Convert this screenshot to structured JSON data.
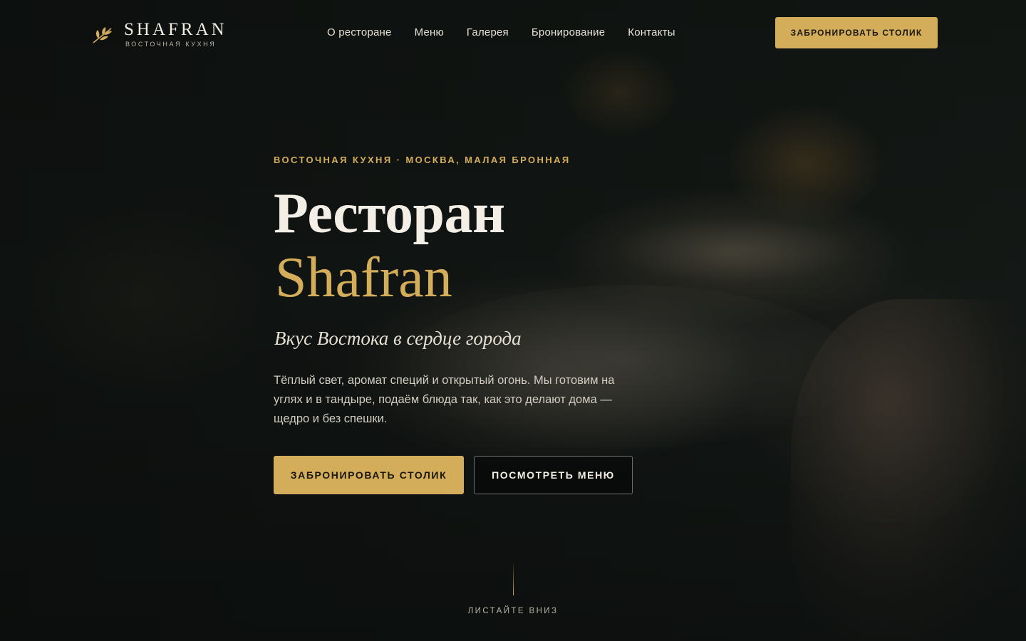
{
  "brand": {
    "name": "SHAFRAN",
    "subtitle": "ВОСТОЧНАЯ КУХНЯ",
    "logo_icon": "leaf-branch-icon",
    "accent_color": "#d3ad59"
  },
  "nav": {
    "items": [
      {
        "label": "О ресторане"
      },
      {
        "label": "Меню"
      },
      {
        "label": "Галерея"
      },
      {
        "label": "Бронирование"
      },
      {
        "label": "Контакты"
      }
    ],
    "cta_label": "ЗАБРОНИРОВАТЬ СТОЛИК"
  },
  "hero": {
    "eyebrow": "ВОСТОЧНАЯ КУХНЯ · МОСКВА, МАЛАЯ БРОННАЯ",
    "title_line1": "Ресторан",
    "title_line2": "Shafran",
    "tagline": "Вкус Востока в сердце города",
    "description": "Тёплый свет, аромат специй и открытый огонь. Мы готовим на углях и в тандыре, подаём блюда так, как это делают дома — щедро и без спешки.",
    "primary_button": "ЗАБРОНИРОВАТЬ СТОЛИК",
    "secondary_button": "ПОСМОТРЕТЬ МЕНЮ"
  },
  "scroll_hint": {
    "label": "ЛИСТАЙТЕ ВНИЗ"
  }
}
